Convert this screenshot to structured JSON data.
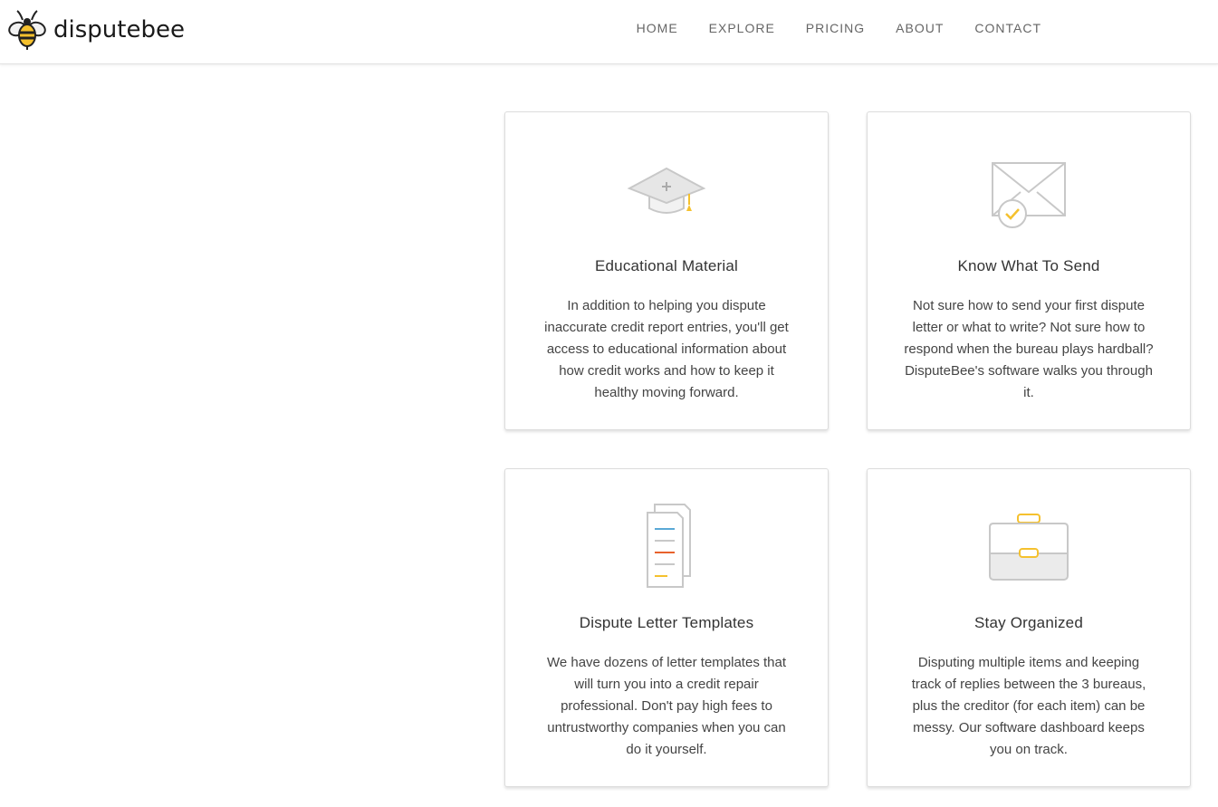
{
  "header": {
    "brand": "disputebee",
    "nav": [
      {
        "label": "HOME"
      },
      {
        "label": "EXPLORE"
      },
      {
        "label": "PRICING"
      },
      {
        "label": "ABOUT"
      },
      {
        "label": "CONTACT"
      }
    ]
  },
  "features": [
    {
      "icon": "graduation-cap-icon",
      "title": "Educational Material",
      "text": "In addition to helping you dispute inaccurate credit report entries, you'll get access to educational information about how credit works and how to keep it healthy moving forward."
    },
    {
      "icon": "envelope-check-icon",
      "title": "Know What To Send",
      "text": "Not sure how to send your first dispute letter or what to write? Not sure how to respond when the bureau plays hardball? DisputeBee's software walks you through it."
    },
    {
      "icon": "document-templates-icon",
      "title": "Dispute Letter Templates",
      "text": "We have dozens of letter templates that will turn you into a credit repair professional. Don't pay high fees to untrustworthy companies when you can do it yourself."
    },
    {
      "icon": "briefcase-icon",
      "title": "Stay Organized",
      "text": "Disputing multiple items and keeping track of replies between the 3 bureaus, plus the creditor (for each item) can be messy. Our software dashboard keeps you on track."
    }
  ],
  "colors": {
    "accent": "#f5c12e",
    "icon_gray": "#c8c8c8",
    "line_blue": "#5aa9d6",
    "line_orange": "#e8622c"
  }
}
